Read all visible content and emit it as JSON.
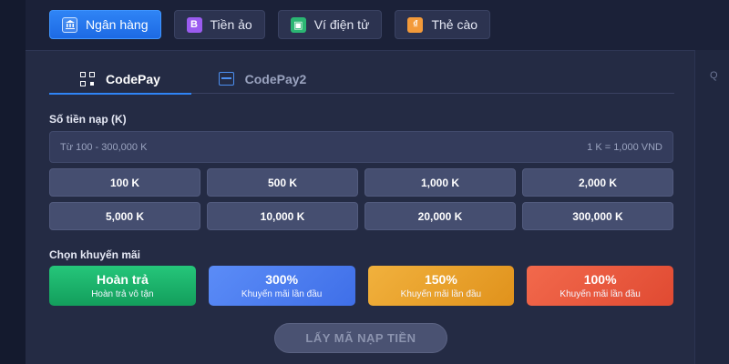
{
  "methods": [
    {
      "label": "Ngân hàng",
      "icon": "bank-icon",
      "glyph": "",
      "active": true
    },
    {
      "label": "Tiền ảo",
      "icon": "bitcoin-icon",
      "glyph": "B",
      "active": false
    },
    {
      "label": "Ví điện tử",
      "icon": "wallet-icon",
      "glyph": "▣",
      "active": false
    },
    {
      "label": "Thẻ cào",
      "icon": "card-icon",
      "glyph": "₫",
      "active": false
    }
  ],
  "sub_tabs": [
    {
      "label": "CodePay",
      "icon": "qr-code-icon",
      "active": true
    },
    {
      "label": "CodePay2",
      "icon": "scan-icon",
      "active": false
    }
  ],
  "amount": {
    "label": "Số tiền nạp (K)",
    "placeholder": "Từ 100 - 300,000 K",
    "rate": "1 K = 1,000 VND"
  },
  "amount_options": [
    "100 K",
    "500 K",
    "1,000 K",
    "2,000 K",
    "5,000 K",
    "10,000 K",
    "20,000 K",
    "300,000 K"
  ],
  "promo": {
    "label": "Chọn khuyến mãi",
    "options": [
      {
        "title": "Hoàn trả",
        "subtitle": "Hoàn trả vô tận",
        "color": "#1fb56c"
      },
      {
        "title": "300%",
        "subtitle": "Khuyến mãi lần đầu",
        "color": "#4f7ff2"
      },
      {
        "title": "150%",
        "subtitle": "Khuyến mãi lần đầu",
        "color": "#e9a22e"
      },
      {
        "title": "100%",
        "subtitle": "Khuyến mãi lần đầu",
        "color": "#ea5a3e"
      }
    ]
  },
  "submit_label": "LẤY MÃ NẠP TIỀN",
  "right_panel_text": "Q",
  "colors": {
    "accent": "#2f84f5",
    "background": "#1b2138",
    "panel": "#242b44"
  }
}
